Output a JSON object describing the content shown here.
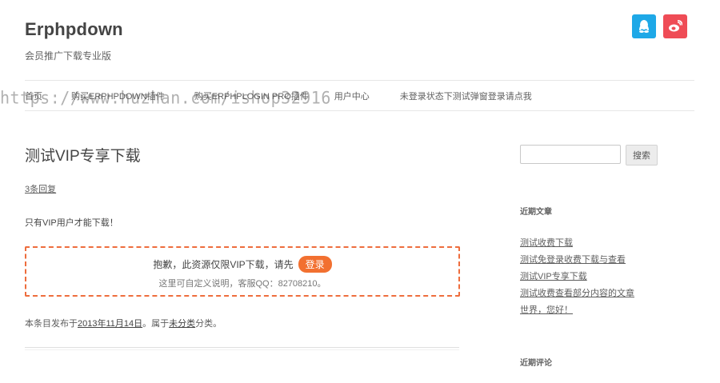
{
  "site": {
    "title": "Erphpdown",
    "description": "会员推广下载专业版"
  },
  "social": [
    {
      "name": "qq-icon",
      "color": "#1ea8e7"
    },
    {
      "name": "weibo-icon",
      "color": "#ef4c56"
    }
  ],
  "nav": {
    "items": [
      {
        "label": "首页"
      },
      {
        "label": "购买ERPHPDOWN插件"
      },
      {
        "label": "购买ERPHPLOGIN PRO插件"
      },
      {
        "label": "用户中心"
      },
      {
        "label": "未登录状态下测试弹窗登录请点我"
      }
    ]
  },
  "watermark": "https://www.huzhan.com/ishop32916",
  "post": {
    "title": "测试VIP专享下载",
    "replies": "3条回复",
    "vip_only": "只有VIP用户才能下载！",
    "notice": {
      "line1": "抱歉，此资源仅限VIP下载，请先",
      "login_label": "登录",
      "line2": "这里可自定义说明，客服QQ：82708210。"
    },
    "meta": {
      "prefix": "本条目发布于",
      "date": "2013年11月14日",
      "middle": "。属于",
      "category": "未分类",
      "suffix": "分类。"
    }
  },
  "sidebar": {
    "search_label": "搜索",
    "search_placeholder": "",
    "recent_posts_title": "近期文章",
    "recent_posts": [
      "测试收费下载",
      "测试免登录收费下载与查看",
      "测试VIP专享下载",
      "测试收费查看部分内容的文章",
      "世界，您好！"
    ],
    "recent_comments_title": "近期评论"
  },
  "colors": {
    "accent": "#ee6d3d",
    "login_button": "#f27030"
  }
}
